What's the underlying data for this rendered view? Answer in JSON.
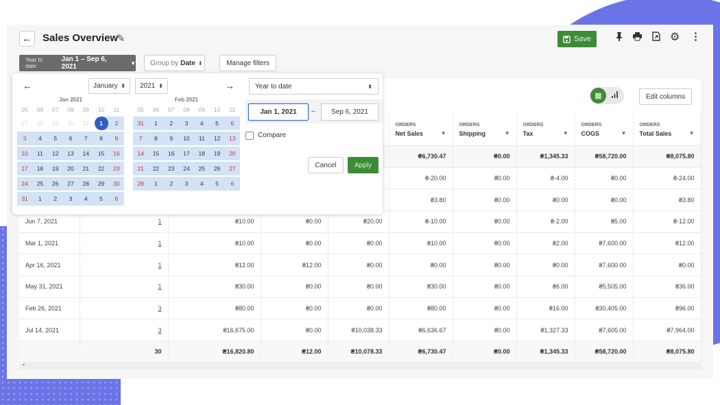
{
  "colors": {
    "accent": "#3d8b37",
    "selection": "#2f5fc4",
    "range": "#d3e2f5",
    "weekend": "#c4303a",
    "background_decor": "#6b74e6"
  },
  "header": {
    "title": "Sales Overview",
    "save_label": "Save",
    "icons": [
      "arrow-left-icon",
      "pencil-icon",
      "save-icon",
      "pin-icon",
      "print-icon",
      "export-icon",
      "gear-icon",
      "more-vertical-icon"
    ]
  },
  "filters": {
    "preset": "Year to date",
    "range": "Jan 1 – Sep 6, 2021",
    "group_by_label": "Group by",
    "group_by_value": "Date",
    "manage_label": "Manage filters"
  },
  "toolbar": {
    "edit_columns": "Edit columns",
    "view": "table"
  },
  "table": {
    "columns": [
      {
        "group": "",
        "label": ""
      },
      {
        "group": "",
        "label": ""
      },
      {
        "group": "",
        "label": ""
      },
      {
        "group": "",
        "label": ""
      },
      {
        "group": "",
        "label": ""
      },
      {
        "group": "ORDERS",
        "label": "Net Sales"
      },
      {
        "group": "ORDERS",
        "label": "Shipping"
      },
      {
        "group": "ORDERS",
        "label": "Tax"
      },
      {
        "group": "ORDERS",
        "label": "COGS"
      },
      {
        "group": "ORDERS",
        "label": "Total Sales"
      }
    ],
    "summary": [
      "",
      "",
      "",
      "",
      "",
      "₴6,730.47",
      "₴0.00",
      "₴1,345.33",
      "₴58,720.00",
      "₴8,075.80"
    ],
    "rows": [
      [
        "",
        "",
        "",
        "",
        "",
        "₴-20.00",
        "₴0.00",
        "₴-4.00",
        "₴0.00",
        "₴-24.00"
      ],
      [
        "",
        "",
        "",
        "",
        "",
        "₴3.80",
        "₴0.00",
        "₴0.00",
        "₴0.00",
        "₴3.80"
      ],
      [
        "Jun 7, 2021",
        "1",
        "₴10.00",
        "₴0.00",
        "₴20.00",
        "₴-10.00",
        "₴0.00",
        "₴-2.00",
        "₴5.00",
        "₴-12.00"
      ],
      [
        "Mar 1, 2021",
        "1",
        "₴10.00",
        "₴0.00",
        "₴0.00",
        "₴10.00",
        "₴0.00",
        "₴2.00",
        "₴7,600.00",
        "₴12.00"
      ],
      [
        "Apr 16, 2021",
        "1",
        "₴12.00",
        "₴12.00",
        "₴0.00",
        "₴0.00",
        "₴0.00",
        "₴0.00",
        "₴7,600.00",
        "₴0.00"
      ],
      [
        "May 31, 2021",
        "1",
        "₴30.00",
        "₴0.00",
        "₴0.00",
        "₴30.00",
        "₴0.00",
        "₴6.00",
        "₴5,505.00",
        "₴36.00"
      ],
      [
        "Feb 26, 2021",
        "3",
        "₴80.00",
        "₴0.00",
        "₴0.00",
        "₴80.00",
        "₴0.00",
        "₴16.00",
        "₴30,405.00",
        "₴96.00"
      ],
      [
        "Jul 14, 2021",
        "3",
        "₴16,675.00",
        "₴0.00",
        "₴10,038.33",
        "₴6,636.67",
        "₴0.00",
        "₴1,327.33",
        "₴7,605.00",
        "₴7,964.00"
      ]
    ],
    "totals": [
      "",
      "30",
      "₴16,820.80",
      "₴12.00",
      "₴10,078.33",
      "₴6,730.47",
      "₴0.00",
      "₴1,345.33",
      "₴58,720.00",
      "₴8,075.80"
    ]
  },
  "datepicker": {
    "month_select": "January",
    "year_select": "2021",
    "preset_select": "Year to date",
    "start_date": "Jan 1, 2021",
    "end_date": "Sep 6, 2021",
    "dash": "–",
    "compare_label": "Compare",
    "compare_checked": false,
    "cancel_label": "Cancel",
    "apply_label": "Apply",
    "calendars": [
      {
        "title": "Jan 2021",
        "weekday_labels": [
          "05",
          "06",
          "07",
          "08",
          "09",
          "10",
          "11"
        ],
        "leading_muted": 5,
        "selected": "1",
        "weeks": [
          [
            "27",
            "28",
            "29",
            "30",
            "31",
            "1",
            "2"
          ],
          [
            "3",
            "4",
            "5",
            "6",
            "7",
            "8",
            "9"
          ],
          [
            "10",
            "11",
            "12",
            "13",
            "14",
            "15",
            "16"
          ],
          [
            "17",
            "18",
            "19",
            "20",
            "21",
            "22",
            "23"
          ],
          [
            "24",
            "25",
            "26",
            "27",
            "28",
            "29",
            "30"
          ],
          [
            "31",
            "1",
            "2",
            "3",
            "4",
            "5",
            "6"
          ]
        ]
      },
      {
        "title": "Feb 2021",
        "weekday_labels": [
          "05",
          "06",
          "07",
          "08",
          "09",
          "10",
          "11"
        ],
        "leading_muted": 0,
        "selected": null,
        "weeks": [
          [
            "31",
            "1",
            "2",
            "3",
            "4",
            "5",
            "6"
          ],
          [
            "7",
            "8",
            "9",
            "10",
            "11",
            "12",
            "13"
          ],
          [
            "14",
            "15",
            "16",
            "17",
            "18",
            "19",
            "20"
          ],
          [
            "21",
            "22",
            "23",
            "24",
            "25",
            "26",
            "27"
          ],
          [
            "28",
            "1",
            "2",
            "3",
            "4",
            "5",
            "6"
          ]
        ]
      }
    ]
  }
}
